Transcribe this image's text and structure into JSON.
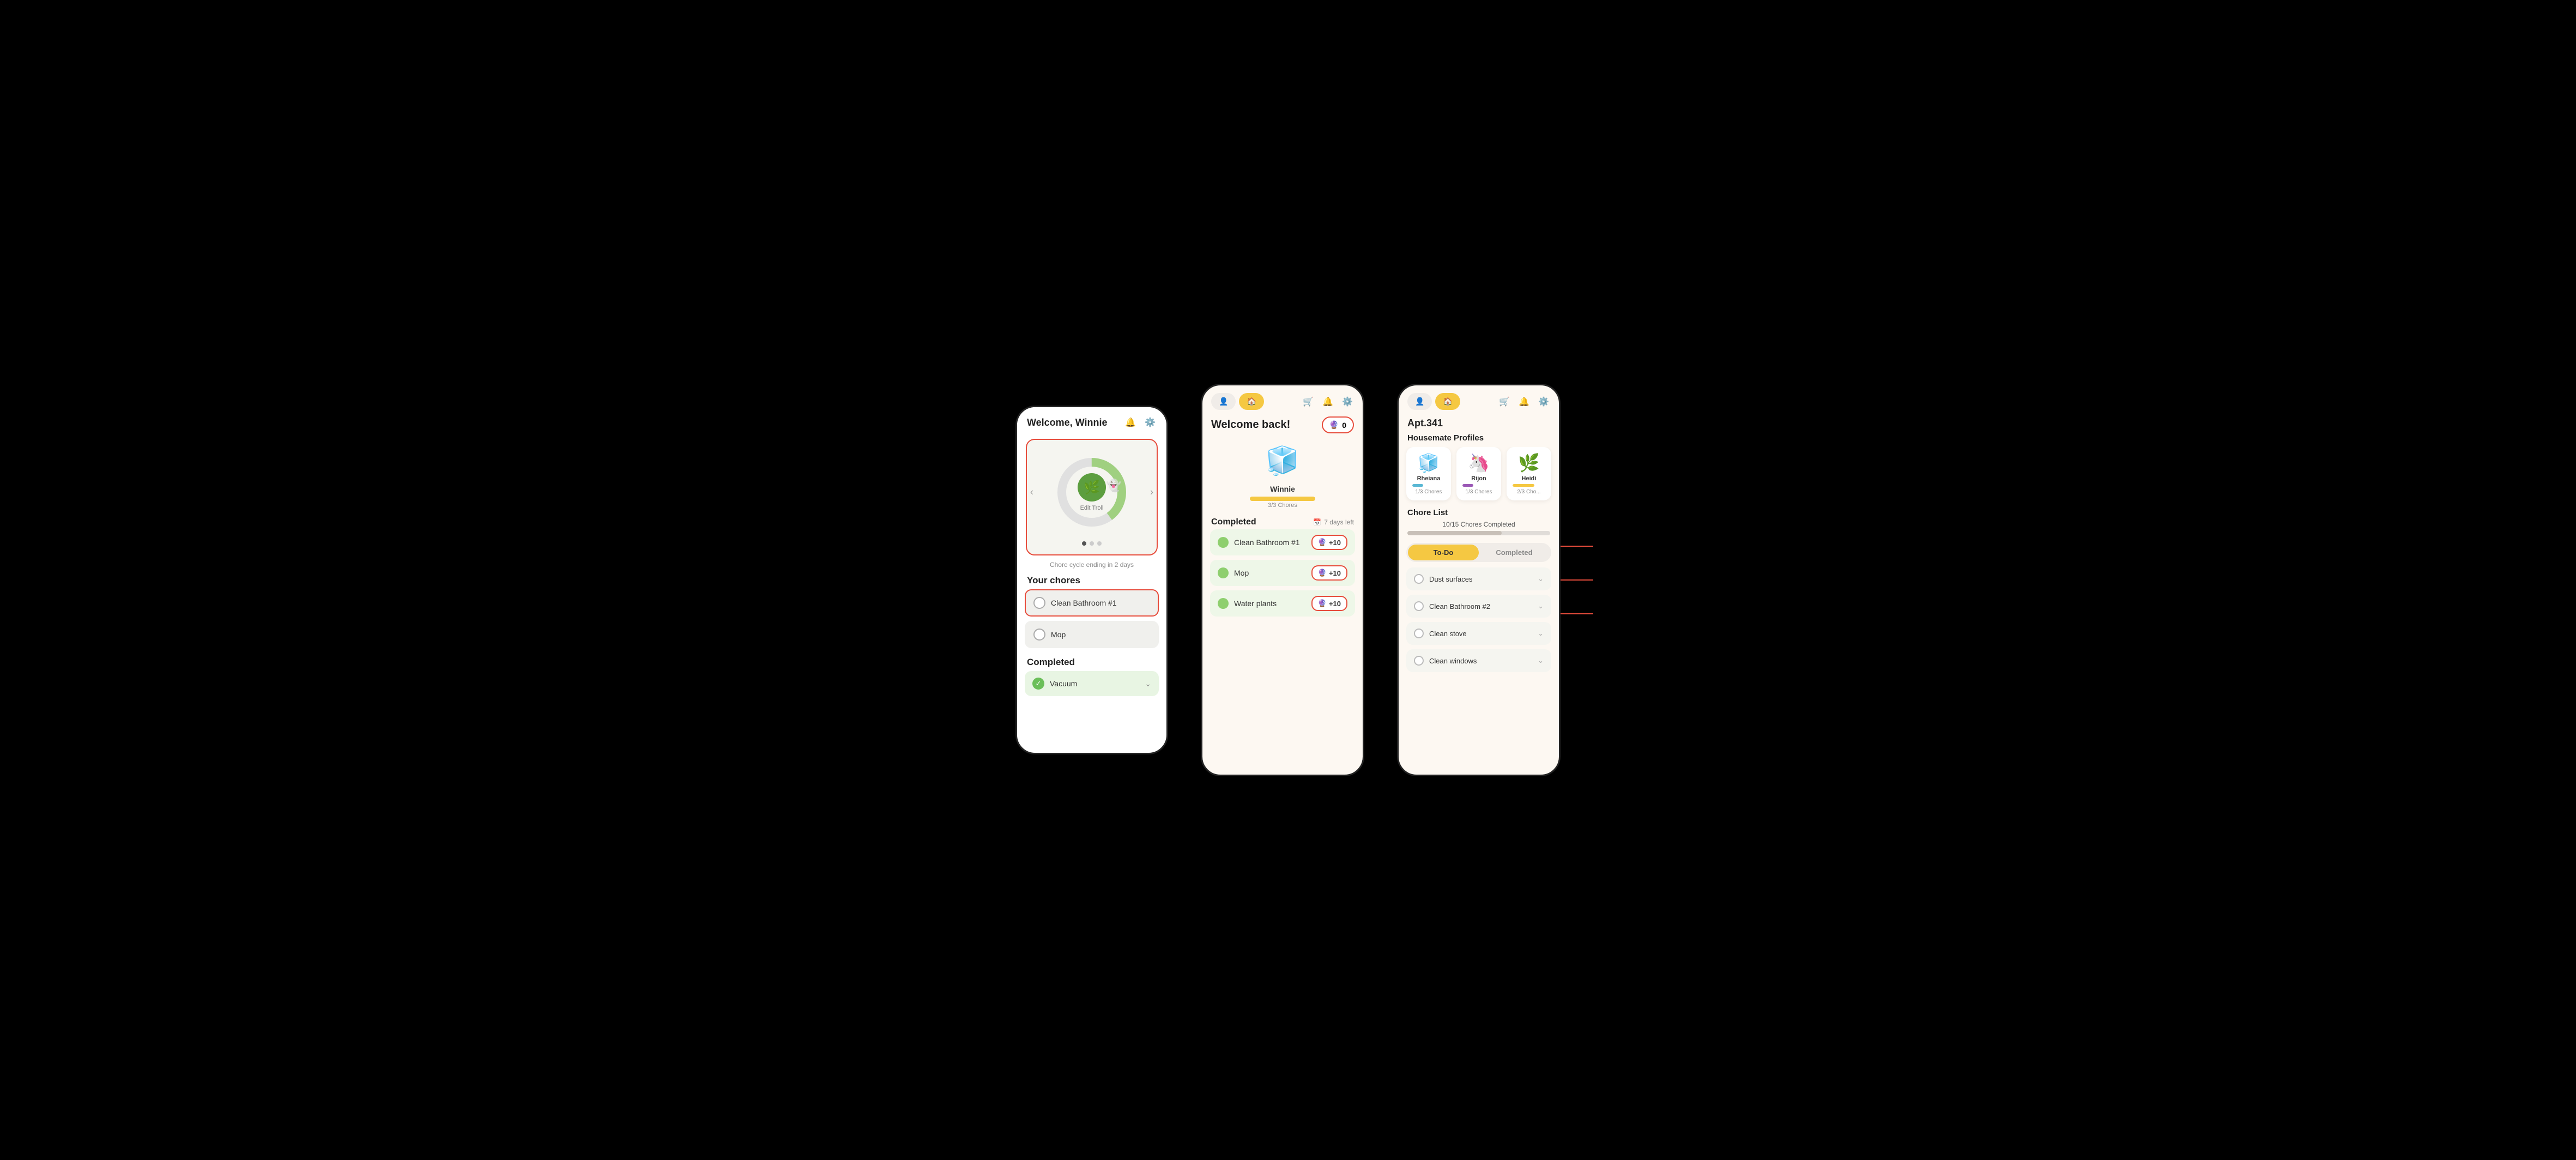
{
  "phone1": {
    "header": {
      "title": "Welcome, Winnie",
      "bell_icon": "🔔",
      "gear_icon": "⚙️"
    },
    "carousel": {
      "troll_label": "Edit Troll",
      "troll_emoji": "🌿",
      "ghost_emoji": "👻",
      "dots": [
        true,
        false,
        false
      ]
    },
    "cycle_label": "Chore cycle ending in 2 days",
    "your_chores_title": "Your chores",
    "chores": [
      {
        "label": "Clean Bathroom #1",
        "done": false,
        "highlighted": true
      },
      {
        "label": "Mop",
        "done": false,
        "highlighted": false
      }
    ],
    "completed_title": "Completed",
    "completed_chores": [
      {
        "label": "Vacuum"
      }
    ]
  },
  "phone2": {
    "nav": {
      "person_icon": "👤",
      "home_icon": "🏠",
      "cart_icon": "🛒",
      "bell_icon": "🔔",
      "gear_icon": "⚙️",
      "person_tab_label": "",
      "home_tab_label": ""
    },
    "welcome_title": "Welcome back!",
    "coin_count": "0",
    "coin_icon": "🔮",
    "character": {
      "emoji": "🧊",
      "name": "Winnie",
      "progress": 100,
      "chores_label": "3/3 Chores"
    },
    "completed_section": {
      "title": "Completed",
      "days_left": "7 days left",
      "calendar_icon": "📅"
    },
    "completed_chores": [
      {
        "label": "Clean Bathroom #1",
        "points": "+10"
      },
      {
        "label": "Mop",
        "points": "+10"
      },
      {
        "label": "Water plants",
        "points": "+10"
      }
    ],
    "points_icon": "🔮"
  },
  "phone3": {
    "nav": {
      "person_icon": "👤",
      "home_icon": "🏠",
      "cart_icon": "🛒",
      "bell_icon": "🔔",
      "gear_icon": "⚙️"
    },
    "apt_title": "Apt.341",
    "housemates_title": "Housemate Profiles",
    "housemates": [
      {
        "name": "Rheiana",
        "emoji": "🧊",
        "progress": 33,
        "chores": "1/3 Chores",
        "color": "#5bb8d4"
      },
      {
        "name": "Rijon",
        "emoji": "🦄",
        "progress": 33,
        "chores": "1/3 Chores",
        "color": "#9b59b6"
      },
      {
        "name": "Heidi",
        "emoji": "🌿",
        "progress": 66,
        "chores": "2/3 Cho...",
        "color": "#6bbf59"
      }
    ],
    "chore_list_title": "Chore List",
    "overall_label": "10/15 Chores Completed",
    "overall_progress": 66,
    "tabs": {
      "todo_label": "To-Do",
      "completed_label": "Completed"
    },
    "todo_chores": [
      {
        "label": "Dust surfaces"
      },
      {
        "label": "Clean Bathroom #2"
      },
      {
        "label": "Clean stove"
      },
      {
        "label": "Clean windows"
      }
    ]
  },
  "annotations": {
    "red_color": "#e74c3c"
  }
}
